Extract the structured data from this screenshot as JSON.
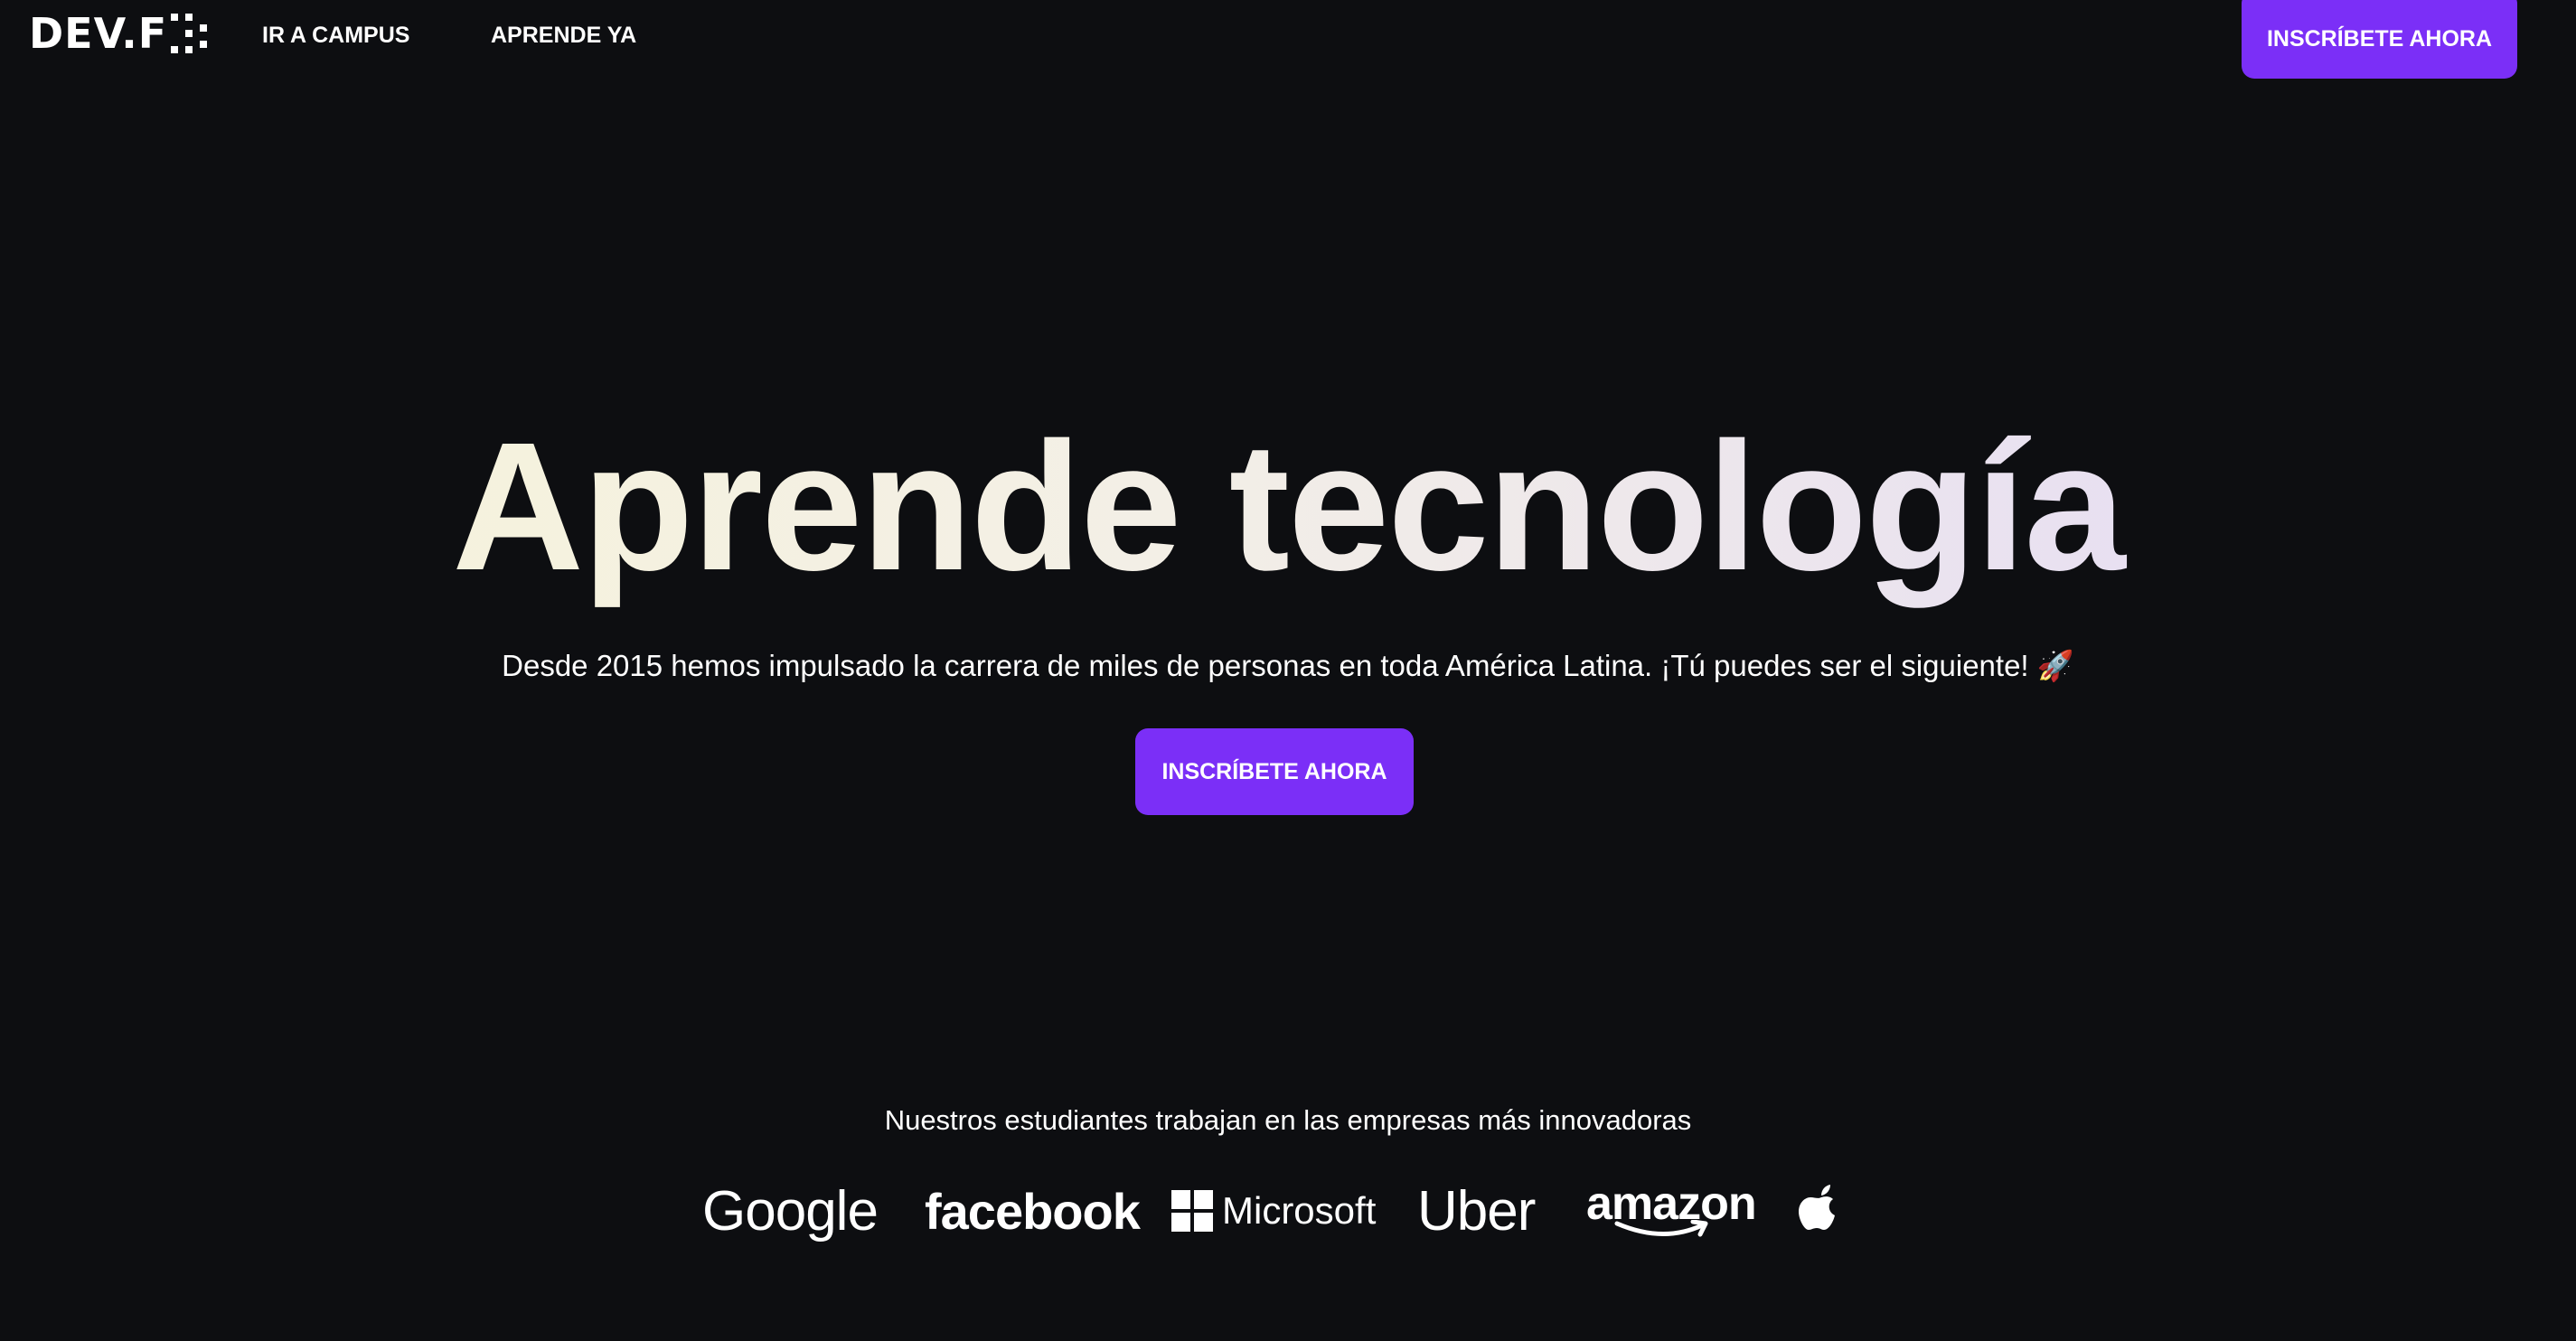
{
  "header": {
    "logo_text": "DEV.F",
    "nav": [
      {
        "label": "IR A CAMPUS"
      },
      {
        "label": "APRENDE YA"
      }
    ],
    "cta_label": "INSCRÍBETE AHORA"
  },
  "hero": {
    "title": "Aprende tecnología",
    "subtitle": "Desde 2015 hemos impulsado la carrera de miles de personas en toda América Latina. ¡Tú puedes ser el siguiente! 🚀",
    "cta_label": "INSCRÍBETE AHORA"
  },
  "companies": {
    "title": "Nuestros estudiantes trabajan en las empresas más innovadoras",
    "logos": [
      {
        "name": "Google",
        "icon": "google-logo"
      },
      {
        "name": "facebook",
        "icon": "facebook-logo"
      },
      {
        "name": "Microsoft",
        "icon": "microsoft-logo"
      },
      {
        "name": "Uber",
        "icon": "uber-logo"
      },
      {
        "name": "amazon",
        "icon": "amazon-logo"
      },
      {
        "name": "",
        "icon": "apple-logo"
      }
    ]
  },
  "colors": {
    "background": "#0d0e11",
    "accent": "#7b2ff7",
    "text": "#ffffff"
  }
}
